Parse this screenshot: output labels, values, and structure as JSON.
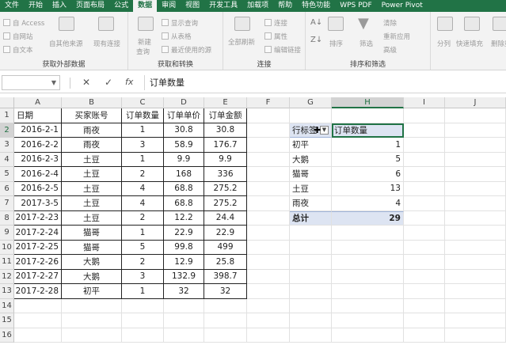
{
  "menu": {
    "tabs": [
      "文件",
      "开始",
      "插入",
      "页面布局",
      "公式",
      "数据",
      "审阅",
      "视图",
      "开发工具",
      "加载项",
      "帮助",
      "特色功能",
      "WPS PDF",
      "Power Pivot"
    ],
    "active": "数据"
  },
  "ribbon": {
    "groups": {
      "external": {
        "label": "获取外部数据",
        "from_access": "自 Access",
        "from_web": "自网站",
        "from_text": "自文本",
        "other_sources": "自其他来源",
        "existing": "现有连接"
      },
      "transform": {
        "label": "获取和转换",
        "new_query": "新建",
        "new_query2": "查询",
        "show_queries": "显示查询",
        "from_table": "从表格",
        "recent_sources": "最近使用的源"
      },
      "connections": {
        "label": "连接",
        "refresh_all": "全部刷新",
        "connections": "连接",
        "properties": "属性",
        "edit_links": "编辑链接"
      },
      "sort_filter": {
        "label": "排序和筛选",
        "sort": "排序",
        "filter": "筛选",
        "clear": "清除",
        "reapply": "重新应用",
        "advanced": "高级"
      },
      "data_tools": {
        "split": "分列",
        "flash_fill": "快速填充",
        "remove_dup": "删除重复"
      }
    }
  },
  "formula_bar": {
    "name_box": "",
    "content": "订单数量"
  },
  "sheet": {
    "columns": [
      "A",
      "B",
      "C",
      "D",
      "E",
      "F",
      "G",
      "H",
      "I",
      "J"
    ],
    "rows": [
      "1",
      "2",
      "3",
      "4",
      "5",
      "6",
      "7",
      "8",
      "9",
      "10",
      "11",
      "12",
      "13",
      "14",
      "15",
      "16"
    ],
    "headers": [
      "日期",
      "买家账号",
      "订单数量",
      "订单单价",
      "订单金额"
    ],
    "data": [
      [
        "2016-2-1",
        "雨夜",
        "1",
        "30.8",
        "30.8"
      ],
      [
        "2016-2-2",
        "雨夜",
        "3",
        "58.9",
        "176.7"
      ],
      [
        "2016-2-3",
        "土豆",
        "1",
        "9.9",
        "9.9"
      ],
      [
        "2016-2-4",
        "土豆",
        "2",
        "168",
        "336"
      ],
      [
        "2016-2-5",
        "土豆",
        "4",
        "68.8",
        "275.2"
      ],
      [
        "2017-3-5",
        "土豆",
        "4",
        "68.8",
        "275.2"
      ],
      [
        "2017-2-23",
        "土豆",
        "2",
        "12.2",
        "24.4"
      ],
      [
        "2017-2-24",
        "猫哥",
        "1",
        "22.9",
        "22.9"
      ],
      [
        "2017-2-25",
        "猫哥",
        "5",
        "99.8",
        "499"
      ],
      [
        "2017-2-26",
        "大鹅",
        "2",
        "12.9",
        "25.8"
      ],
      [
        "2017-2-27",
        "大鹅",
        "3",
        "132.9",
        "398.7"
      ],
      [
        "2017-2-28",
        "初平",
        "1",
        "32",
        "32"
      ]
    ]
  },
  "pivot": {
    "row_label": "行标签",
    "value_label": "订单数量",
    "rows": [
      [
        "初平",
        "1"
      ],
      [
        "大鹅",
        "5"
      ],
      [
        "猫哥",
        "6"
      ],
      [
        "土豆",
        "13"
      ],
      [
        "雨夜",
        "4"
      ]
    ],
    "total_label": "总计",
    "total_value": "29"
  }
}
